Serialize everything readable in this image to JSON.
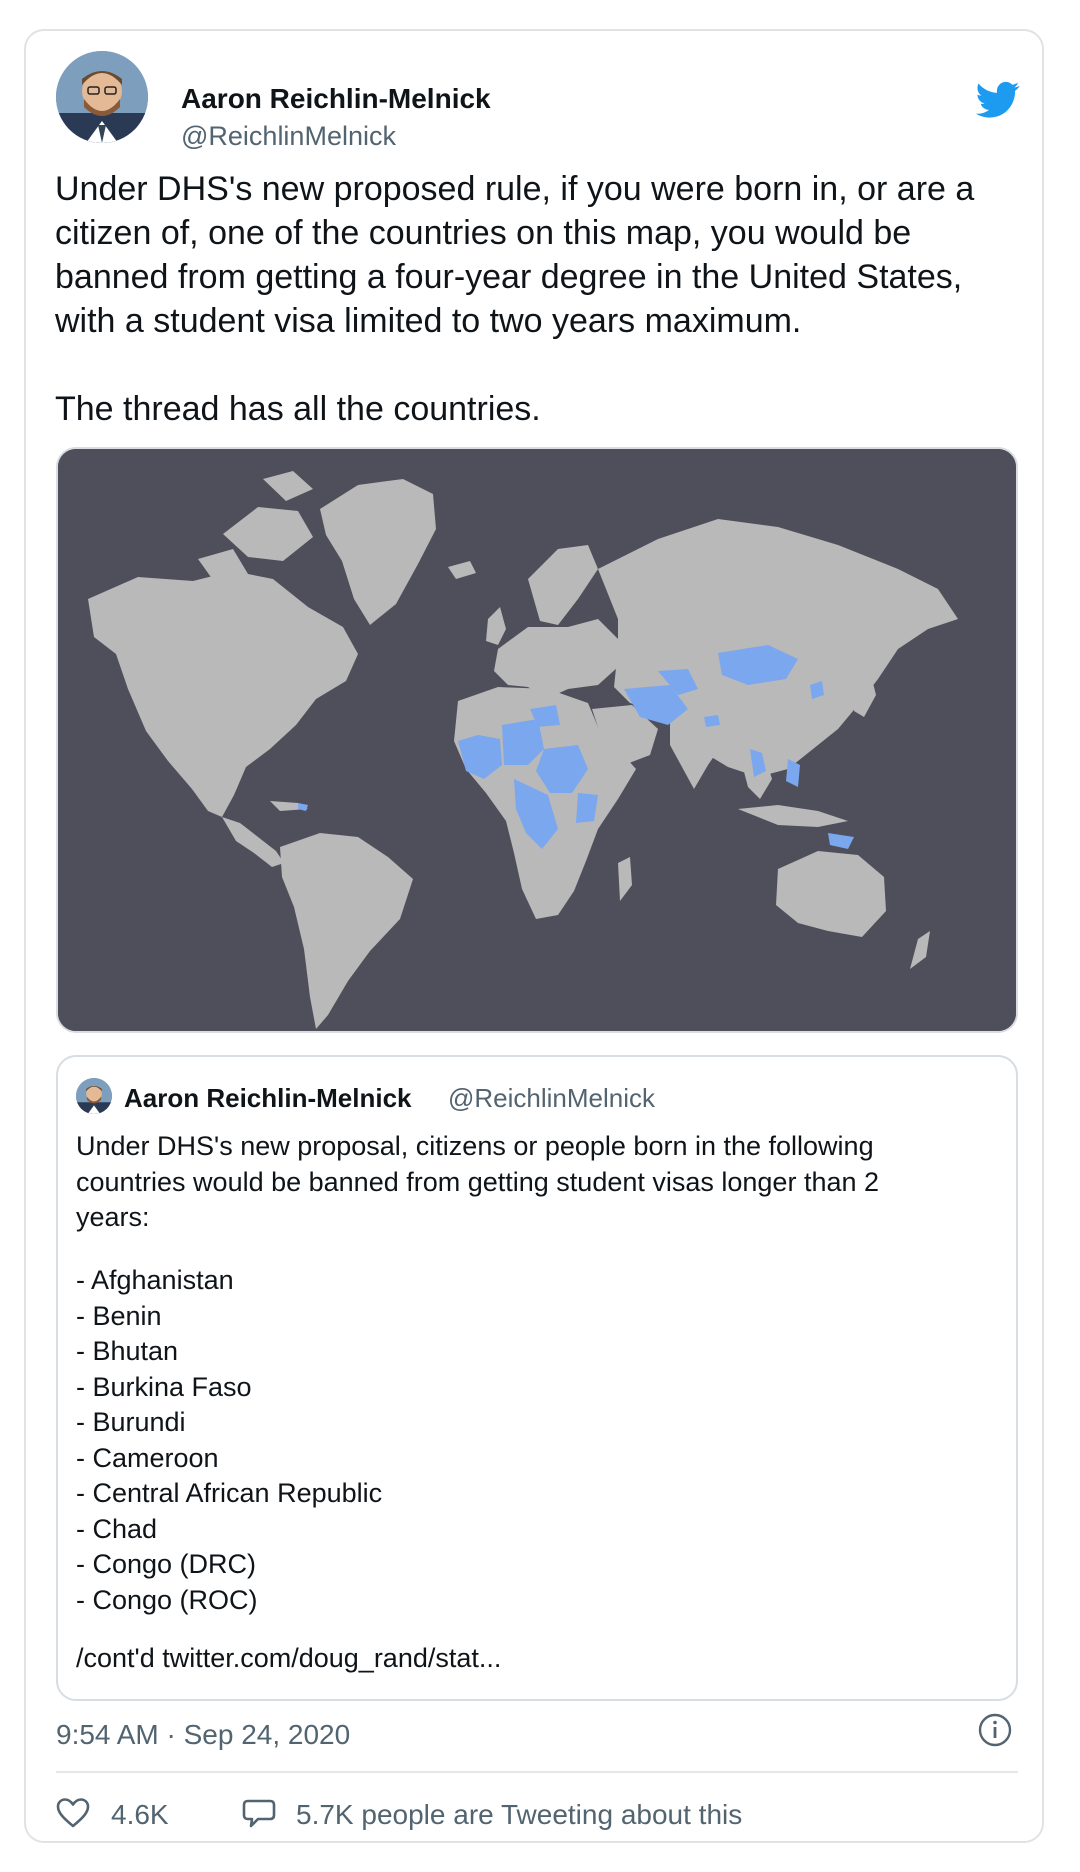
{
  "tweet": {
    "author_name": "Aaron Reichlin-Melnick",
    "author_handle": "@ReichlinMelnick",
    "body": "Under DHS's new proposed rule, if you were born in, or are a\ncitizen of, one of the countries on this map, you would be\nbanned from getting a four-year degree in the United States,\nwith a student visa limited to two years maximum.\n\nThe thread has all the countries.",
    "timestamp": "9:54 AM · Sep 24, 2020",
    "likes": "4.6K",
    "tweeting_about": "5.7K people are Tweeting about this"
  },
  "quote": {
    "author_name": "Aaron Reichlin-Melnick",
    "author_handle": "@ReichlinMelnick",
    "intro": "Under DHS's new proposal, citizens or people born in the following\ncountries would be banned from getting student visas longer than 2\nyears:",
    "countries": [
      "- Afghanistan",
      "- Benin",
      "- Bhutan",
      "- Burkina Faso",
      "- Burundi",
      "- Cameroon",
      "- Central African Republic",
      "- Chad",
      "- Congo (DRC)",
      "- Congo (ROC)"
    ],
    "continuation": "/cont'd twitter.com/doug_rand/stat..."
  },
  "colors": {
    "map_background": "#4f4f5c",
    "land": "#b9b9b9",
    "highlighted_countries": "#7ba7ee",
    "twitter_blue": "#1d9bf0"
  },
  "icons": {
    "bird": "twitter-bird-icon",
    "info": "info-icon",
    "like": "heart-icon",
    "reply": "speech-bubble-icon"
  }
}
